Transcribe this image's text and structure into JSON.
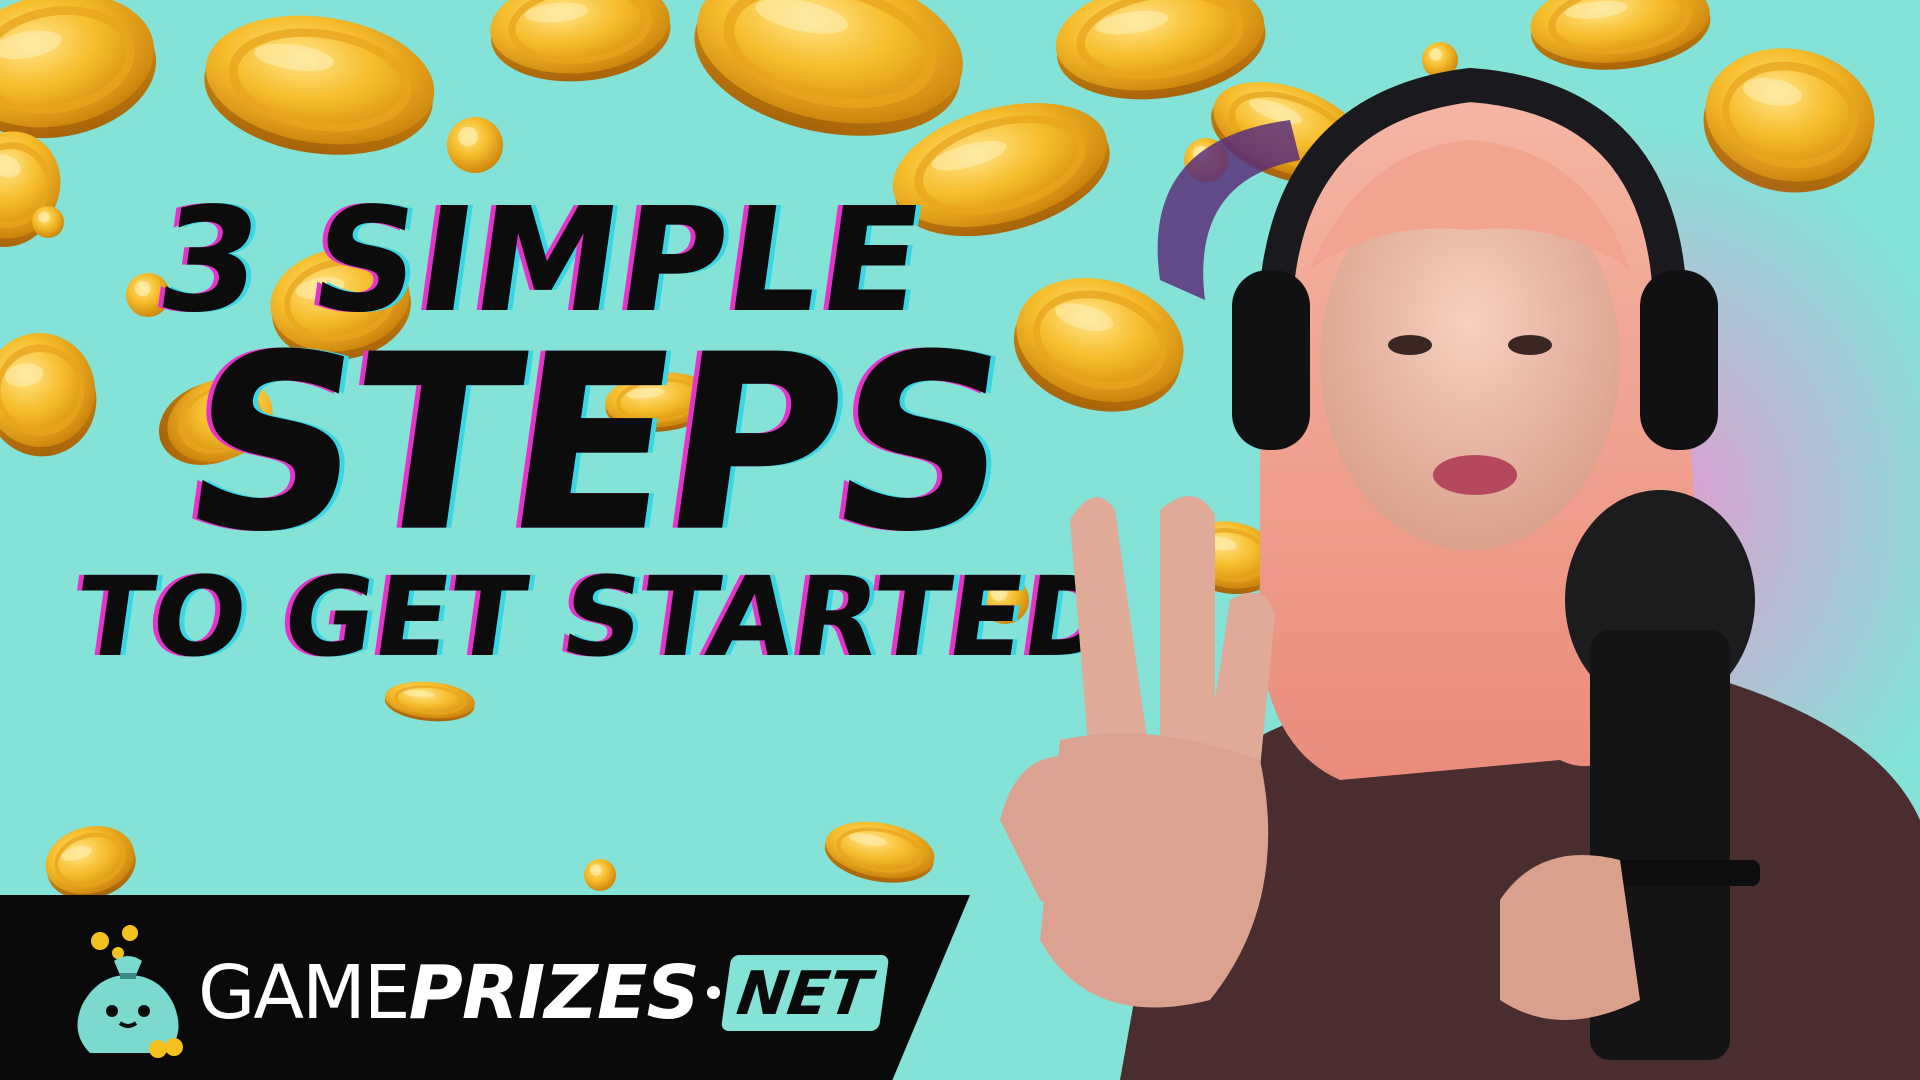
{
  "headline": {
    "line1": "3 SIMPLE",
    "line2": "STEPS",
    "line3": "TO GET STARTED"
  },
  "logo": {
    "game": "GAME",
    "prizes": "PRIZES",
    "net": "NET",
    "icon": "money-bag-icon"
  },
  "colors": {
    "background": "#84E2D7",
    "headline_text": "#0C0C0C",
    "glitch_pink": "#E434C8",
    "glitch_cyan": "#39D7E6",
    "coin_gold": "#F4B31E",
    "banner": "#0A0A0A",
    "hair": "#F2A38E"
  }
}
